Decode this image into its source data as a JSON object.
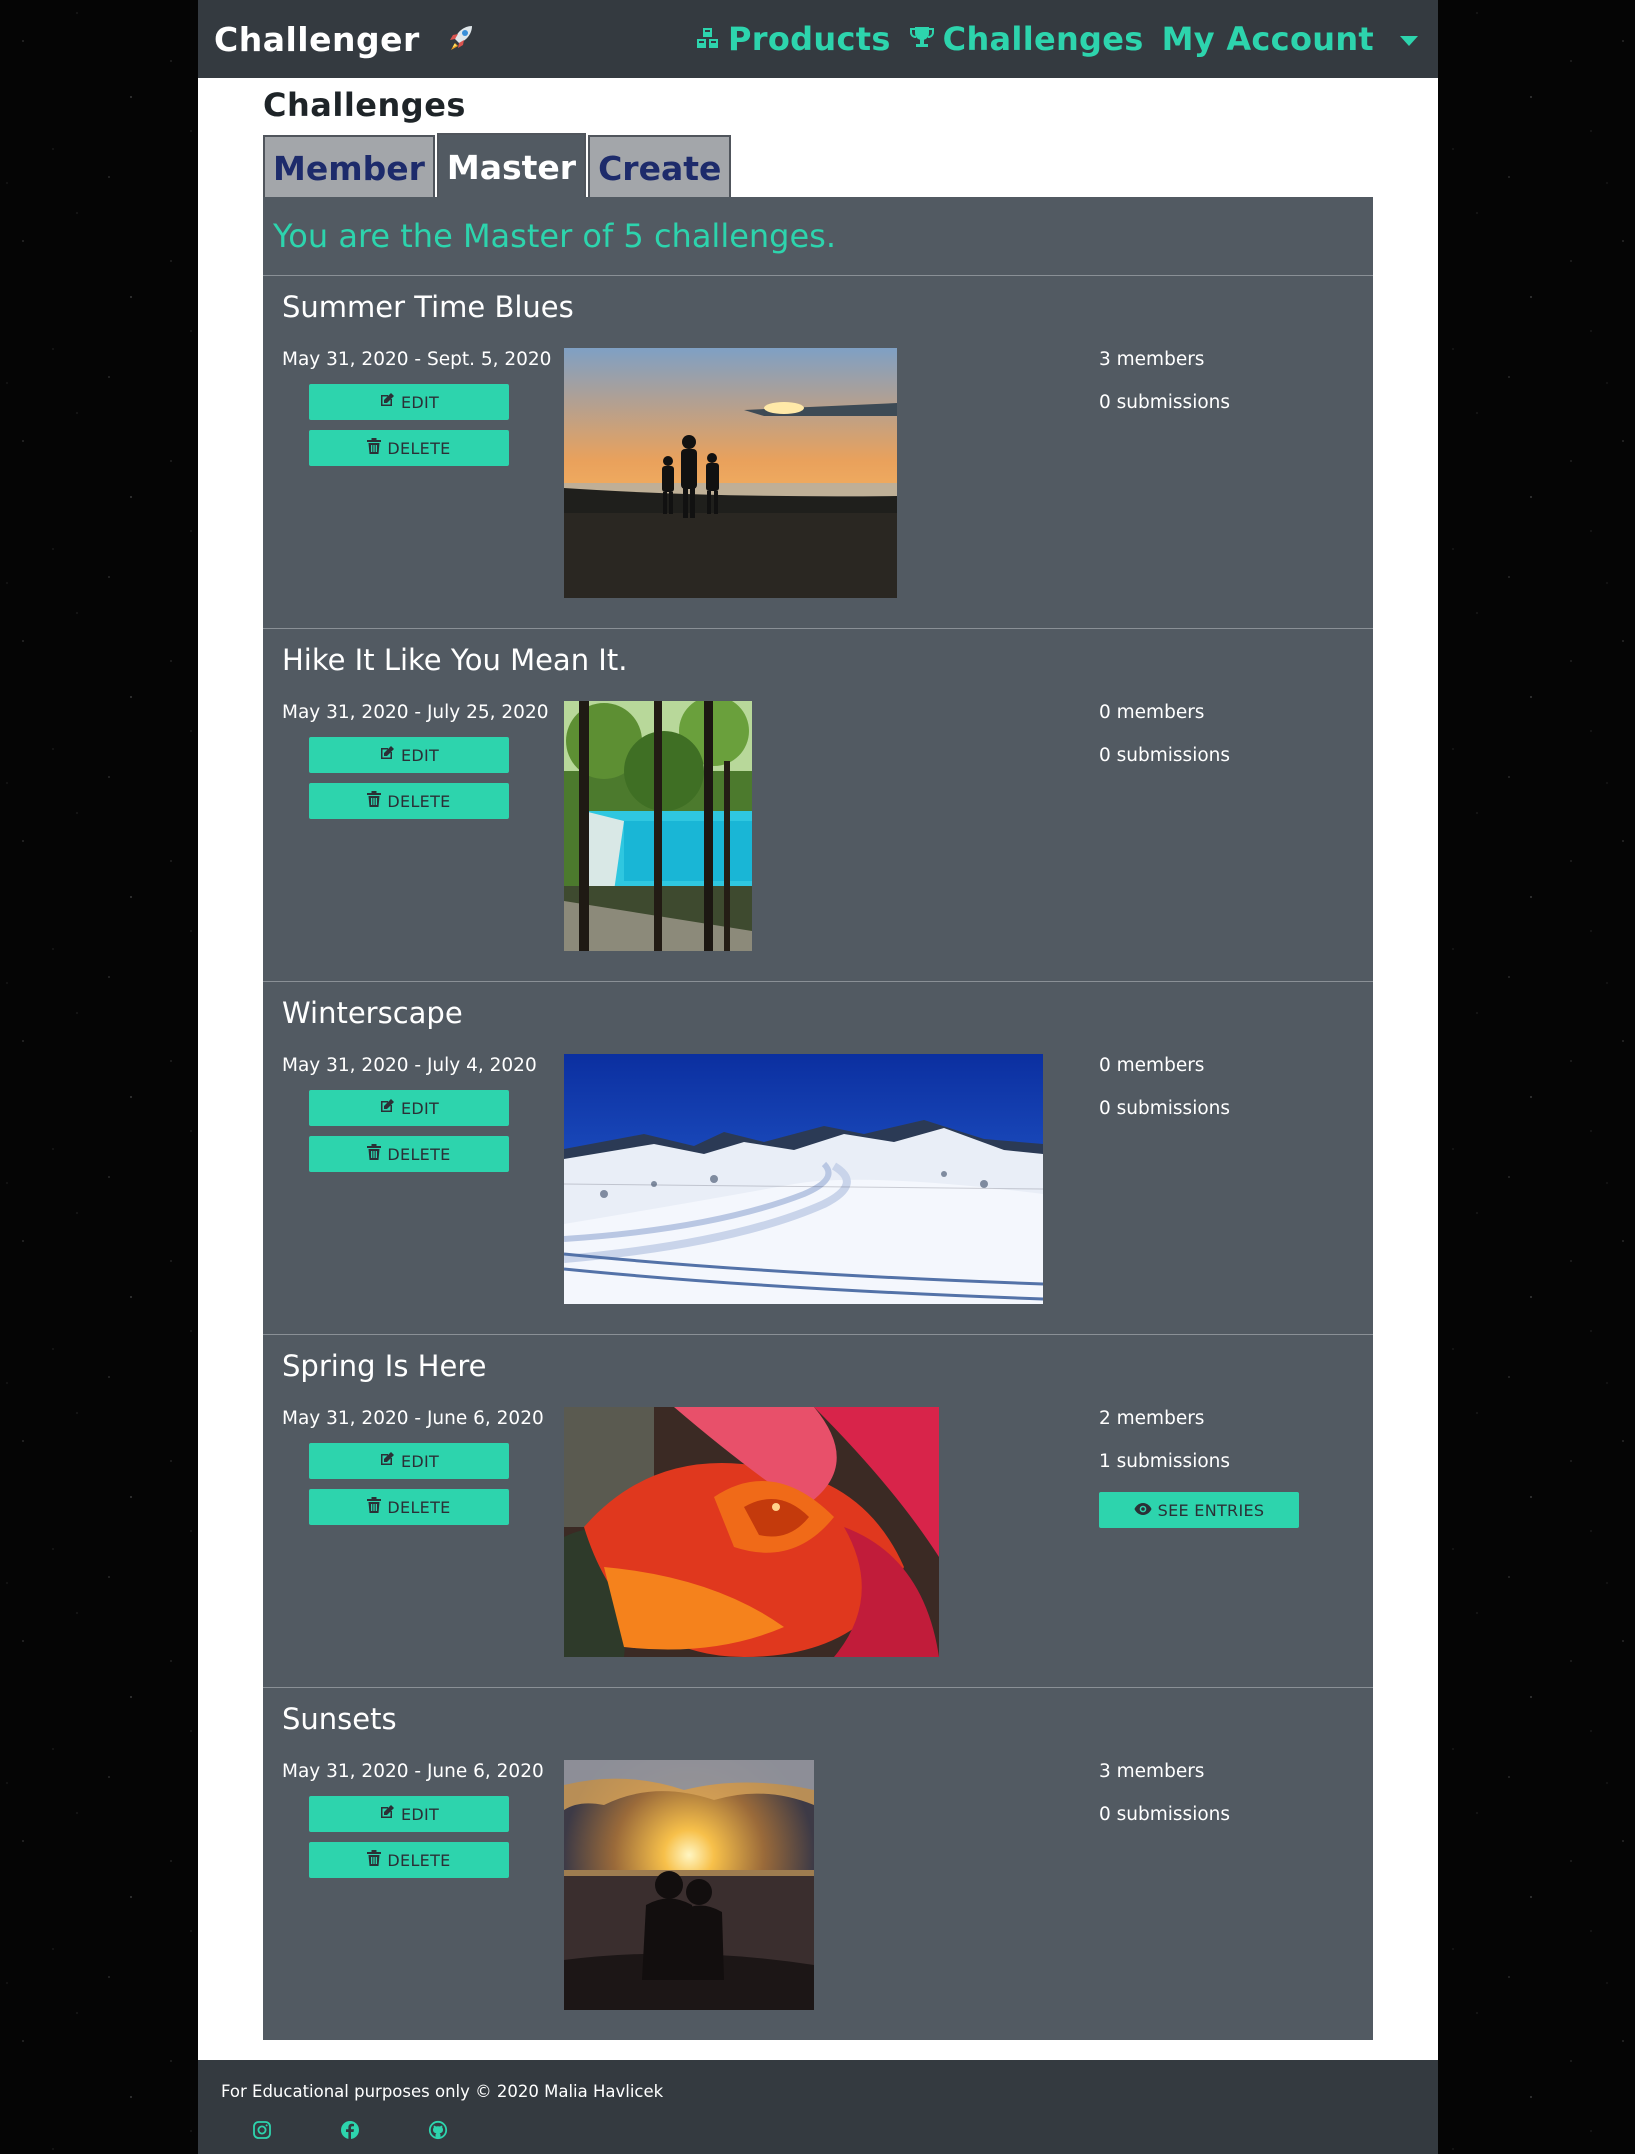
{
  "nav": {
    "brand": "Challenger",
    "products": "Products",
    "challenges": "Challenges",
    "account": "My Account"
  },
  "page_title": "Challenges",
  "tabs": [
    {
      "label": "Member",
      "active": false
    },
    {
      "label": "Master",
      "active": true
    },
    {
      "label": "Create",
      "active": false
    }
  ],
  "banner": "You are the Master of 5 challenges.",
  "buttons": {
    "edit": "EDIT",
    "delete": "DELETE",
    "see_entries": "SEE ENTRIES"
  },
  "challenges": [
    {
      "title": "Summer Time Blues",
      "dates": "May 31, 2020 - Sept. 5, 2020",
      "members": "3 members",
      "submissions": "0 submissions",
      "image": "beach-sunset-family"
    },
    {
      "title": "Hike It Like You Mean It.",
      "dates": "May 31, 2020 - July 25, 2020",
      "members": "0 members",
      "submissions": "0 submissions",
      "image": "forest-turquoise-lake"
    },
    {
      "title": "Winterscape",
      "dates": "May 31, 2020 - July 4, 2020",
      "members": "0 members",
      "submissions": "0 submissions",
      "image": "snowy-mountain-road"
    },
    {
      "title": "Spring Is Here",
      "dates": "May 31, 2020 - June 6, 2020",
      "members": "2 members",
      "submissions": "1 submissions",
      "image": "red-orange-rose"
    },
    {
      "title": "Sunsets",
      "dates": "May 31, 2020 - June 6, 2020",
      "members": "3 members",
      "submissions": "0 submissions",
      "image": "couple-sunset-sea"
    }
  ],
  "footer": {
    "text": "For Educational purposes only © 2020 Malia Havlicek",
    "icons": [
      "instagram-icon",
      "facebook-icon",
      "github-icon"
    ]
  },
  "colors": {
    "accent": "#2dd4ad",
    "navbar": "#343a40",
    "panel": "#525a62",
    "tab_text": "#1d2b6b"
  }
}
